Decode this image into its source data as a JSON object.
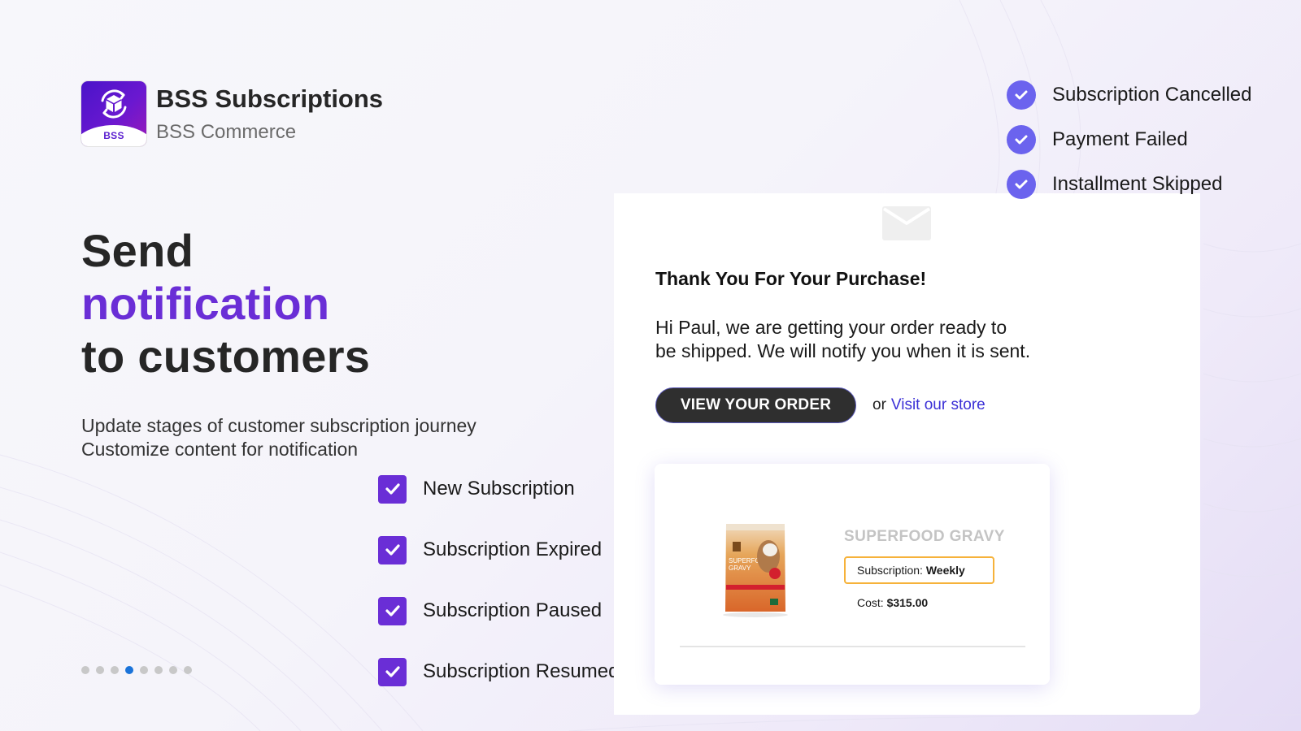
{
  "app": {
    "name": "BSS Subscriptions",
    "vendor": "BSS Commerce",
    "logo_text": "BSS",
    "logo_icon": "box-refresh-icon"
  },
  "hero": {
    "line1": "Send",
    "line2": "notification",
    "line3": "to customers"
  },
  "subtitle": {
    "line1": "Update stages of customer subscription journey",
    "line2": "Customize content for notification"
  },
  "checklist": [
    {
      "label": "New Subscription",
      "checked": true
    },
    {
      "label": "Subscription Expired",
      "checked": true
    },
    {
      "label": "Subscription Paused",
      "checked": true
    },
    {
      "label": "Subscription Resumed",
      "checked": true
    }
  ],
  "status_list": [
    {
      "label": "Subscription Cancelled",
      "icon": "check-circle-icon"
    },
    {
      "label": "Payment Failed",
      "icon": "check-circle-icon"
    },
    {
      "label": "Installment Skipped",
      "icon": "check-circle-icon"
    }
  ],
  "email": {
    "icon": "envelope-icon",
    "heading": "Thank You For Your Purchase!",
    "body_line1": "Hi Paul, we are getting your order ready to",
    "body_line2": "be shipped. We will notify you when it is sent.",
    "cta_label": "VIEW YOUR ORDER",
    "or_text": "or",
    "store_link": "Visit our store",
    "product": {
      "title": "SUPERFOOD GRAVY",
      "subscription_label": "Subscription:",
      "subscription_value": "Weekly",
      "cost_label": "Cost:",
      "cost_value": "$315.00",
      "image_alt": "Superfood Gravy pouch"
    }
  },
  "pager": {
    "total": 8,
    "active_index": 3
  },
  "colors": {
    "accent_purple": "#6a2ed6",
    "status_blue": "#6b63ee",
    "badge_orange": "#f6b23a",
    "link_blue": "#3a2fd6",
    "active_dot": "#1a73d9"
  }
}
